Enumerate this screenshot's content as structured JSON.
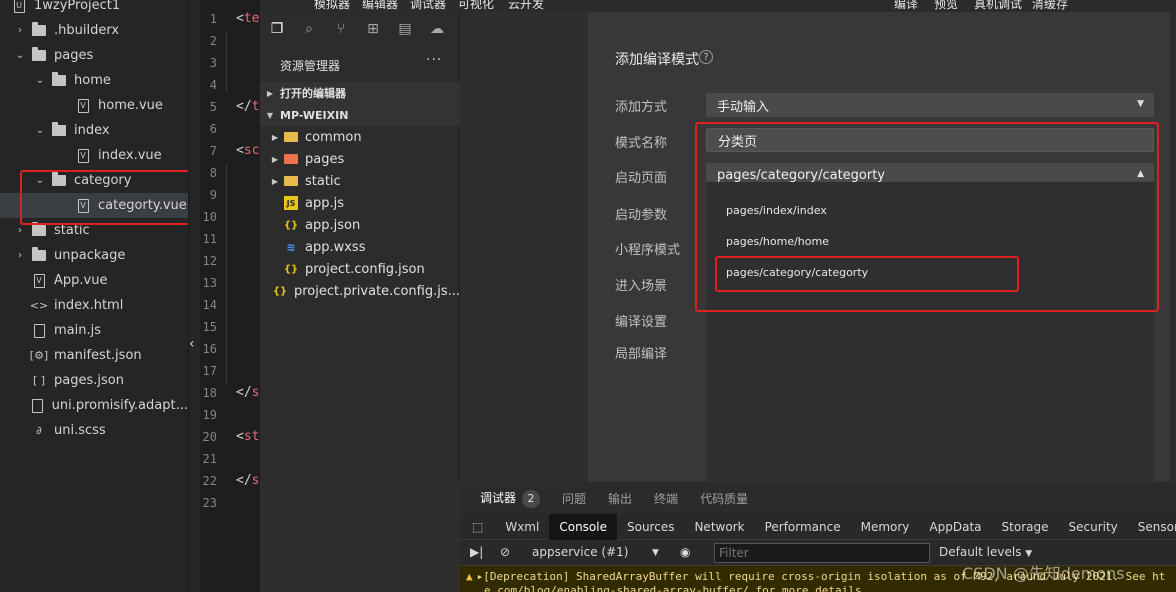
{
  "explorer": {
    "items": [
      {
        "label": "1wzyProject1",
        "kind": "project"
      },
      {
        "label": ".hbuilderx",
        "kind": "folder",
        "expanded": false
      },
      {
        "label": "pages",
        "kind": "folder",
        "expanded": true
      },
      {
        "label": "home",
        "kind": "folder",
        "expanded": true
      },
      {
        "label": "home.vue",
        "kind": "vue"
      },
      {
        "label": "index",
        "kind": "folder",
        "expanded": true
      },
      {
        "label": "index.vue",
        "kind": "vue"
      },
      {
        "label": "category",
        "kind": "folder",
        "expanded": true
      },
      {
        "label": "categorty.vue",
        "kind": "vue"
      },
      {
        "label": "static",
        "kind": "folder",
        "expanded": false
      },
      {
        "label": "unpackage",
        "kind": "folder",
        "expanded": false
      },
      {
        "label": "App.vue",
        "kind": "vue"
      },
      {
        "label": "index.html",
        "kind": "html"
      },
      {
        "label": "main.js",
        "kind": "js"
      },
      {
        "label": "manifest.json",
        "kind": "manifest"
      },
      {
        "label": "pages.json",
        "kind": "json"
      },
      {
        "label": "uni.promisify.adapt...",
        "kind": "js"
      },
      {
        "label": "uni.scss",
        "kind": "scss"
      }
    ]
  },
  "editor": {
    "line_numbers": [
      "1",
      "2",
      "3",
      "4",
      "5",
      "6",
      "7",
      "8",
      "9",
      "10",
      "11",
      "12",
      "13",
      "14",
      "15",
      "16",
      "17",
      "18",
      "19",
      "20",
      "21",
      "22",
      "23"
    ],
    "code": [
      {
        "line": 1,
        "text": "<te"
      },
      {
        "line": 5,
        "text": "</t"
      },
      {
        "line": 7,
        "text": "<sc"
      },
      {
        "line": 18,
        "text": "</s"
      },
      {
        "line": 20,
        "text": "<st"
      },
      {
        "line": 22,
        "text": "</s"
      }
    ]
  },
  "wx": {
    "top_menu": [
      "模拟器",
      "编辑器",
      "调试器",
      "可视化",
      "云开发",
      "编译",
      "预览",
      "真机调试",
      "清缓存"
    ],
    "sidebar": {
      "title": "资源管理器",
      "more": "···",
      "open_editors": "打开的编辑器",
      "project": "MP-WEIXIN",
      "files": [
        {
          "label": "common",
          "kind": "folder"
        },
        {
          "label": "pages",
          "kind": "folder-red"
        },
        {
          "label": "static",
          "kind": "folder"
        },
        {
          "label": "app.js",
          "kind": "js"
        },
        {
          "label": "app.json",
          "kind": "json"
        },
        {
          "label": "app.wxss",
          "kind": "css"
        },
        {
          "label": "project.config.json",
          "kind": "json"
        },
        {
          "label": "project.private.config.js...",
          "kind": "json"
        }
      ]
    },
    "modal": {
      "title": "添加编译模式",
      "help": "?",
      "labels": [
        "添加方式",
        "模式名称",
        "启动页面",
        "启动参数",
        "小程序模式",
        "进入场景",
        "编译设置",
        "局部编译"
      ],
      "add_method": "手动输入",
      "mode_name": "分类页",
      "start_page": "pages/category/categorty",
      "options": [
        "pages/index/index",
        "pages/home/home",
        "pages/category/categorty"
      ]
    },
    "debugger": {
      "tabs": [
        "调试器",
        "问题",
        "输出",
        "终端",
        "代码质量"
      ],
      "badge": "2",
      "devtools_tabs": [
        "Wxml",
        "Console",
        "Sources",
        "Network",
        "Performance",
        "Memory",
        "AppData",
        "Storage",
        "Security",
        "Sensor"
      ],
      "context": "appservice (#1)",
      "filter_placeholder": "Filter",
      "levels": "Default levels",
      "message_line1": "[Deprecation] SharedArrayBuffer will require cross-origin isolation as of M92, around July 2021. See ht",
      "message_line2": "e.com/blog/enabling-shared-array-buffer/ for more details."
    }
  },
  "watermark": "CSDN @先知demons",
  "colors": {
    "highlight": "#e02020",
    "accent_yellow": "#e8c51a"
  }
}
